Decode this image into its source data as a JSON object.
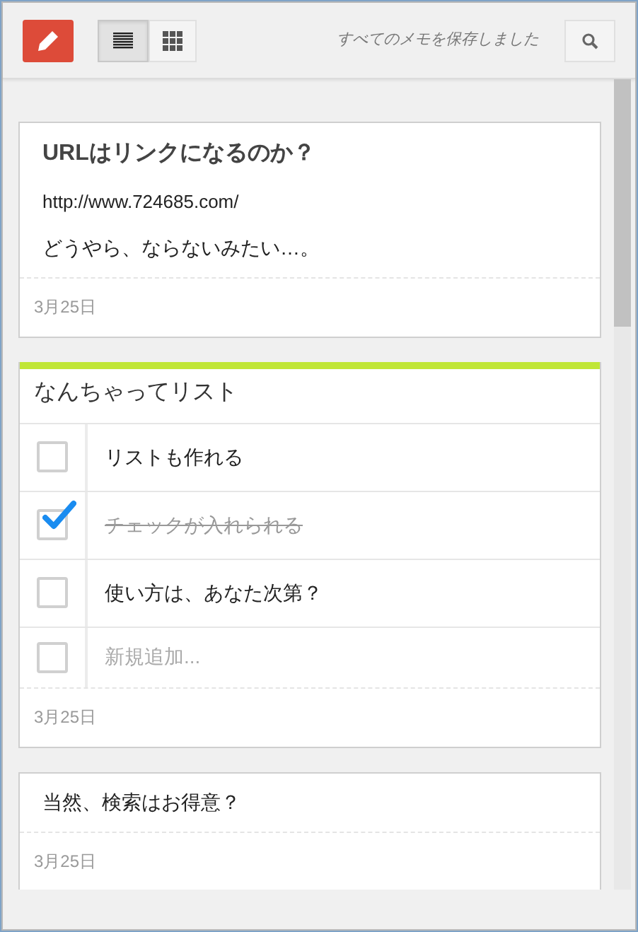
{
  "toolbar": {
    "views": [
      {
        "kind": "list",
        "selected": true
      },
      {
        "kind": "grid",
        "selected": false
      }
    ],
    "status": "すべてのメモを保存しました"
  },
  "notes": [
    {
      "kind": "text",
      "title": "URLはリンクになるのか？",
      "lines": [
        {
          "kind": "link",
          "text": "http://www.724685.com/"
        },
        {
          "kind": "plain",
          "text": "どうやら、ならないみたい…。"
        }
      ],
      "date": "3月25日"
    },
    {
      "kind": "list",
      "color": "#c0e636",
      "title": "なんちゃってリスト",
      "items": [
        {
          "text": "リストも作れる",
          "checked": false
        },
        {
          "text": "チェックが入れられる",
          "checked": true
        },
        {
          "text": "使い方は、あなた次第？",
          "checked": false
        }
      ],
      "add_item": {
        "placeholder": "新規追加...",
        "checked": false
      },
      "date": "3月25日"
    },
    {
      "kind": "text",
      "lines": [
        {
          "kind": "plain",
          "text": "当然、検索はお得意？"
        }
      ],
      "date": "3月25日"
    }
  ]
}
